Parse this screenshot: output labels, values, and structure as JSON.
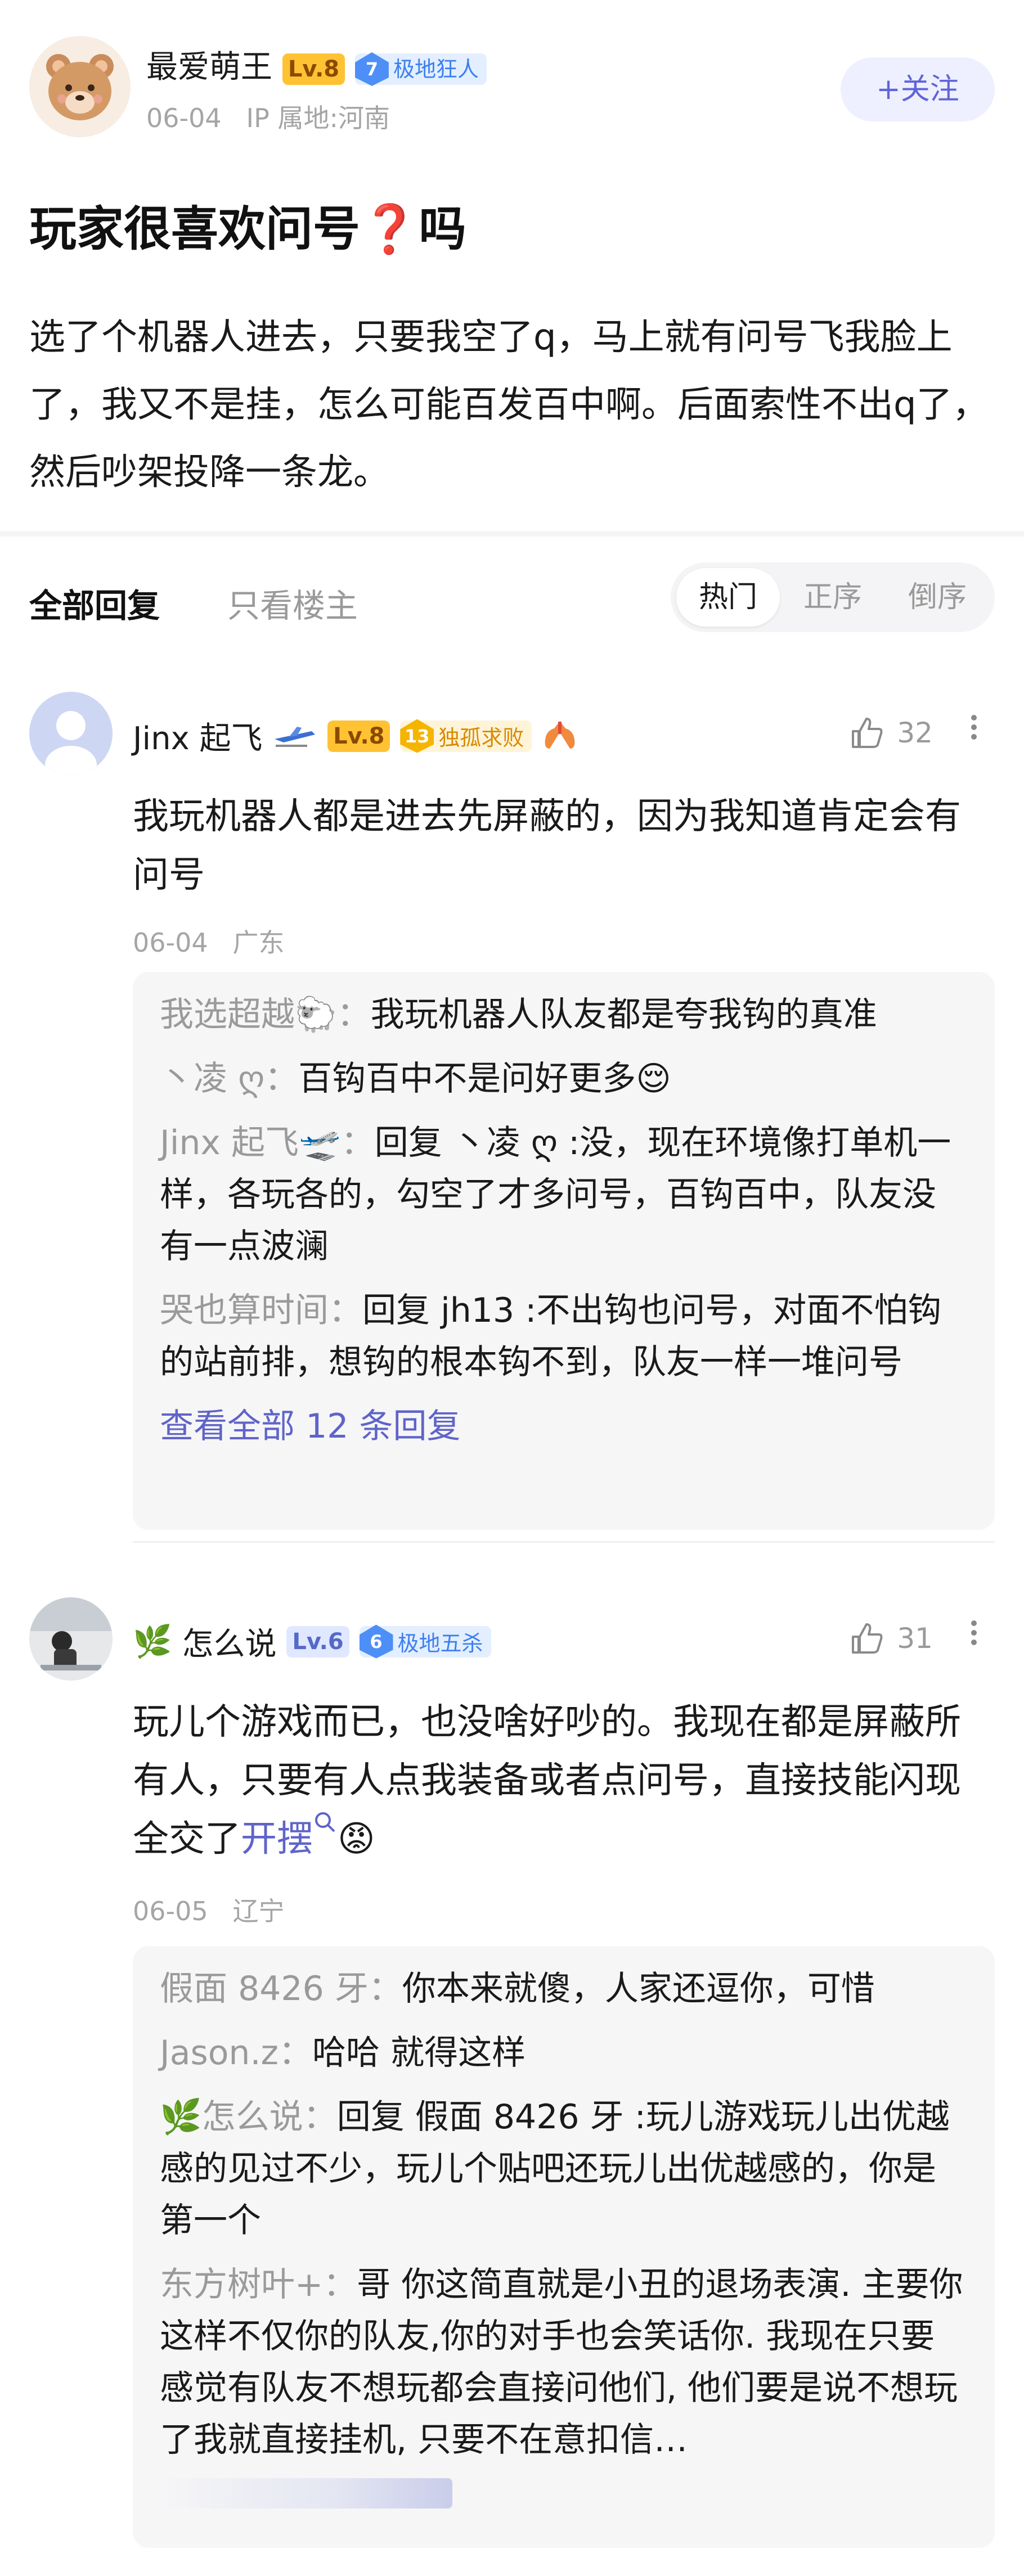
{
  "post": {
    "author": "最爱萌王",
    "level": "Lv.8",
    "tier_number": "7",
    "tier_label": "极地狂人",
    "date": "06-04",
    "ip": "IP 属地:河南",
    "follow_label": "+关注",
    "title": "玩家很喜欢问号",
    "title_suffix": "吗",
    "body": "选了个机器人进去，只要我空了q，马上就有问号飞我脸上了，我又不是挂，怎么可能百发百中啊。后面索性不出q了，然后吵架投降一条龙。"
  },
  "tabs": {
    "all_replies": "全部回复",
    "only_op": "只看楼主",
    "sort": [
      "热门",
      "正序",
      "倒序"
    ]
  },
  "comments": [
    {
      "name": "Jinx 起飞",
      "level": "Lv.8",
      "tier_number": "13",
      "tier_label": "独孤求败",
      "likes": "32",
      "text": "我玩机器人都是进去先屏蔽的，因为我知道肯定会有问号",
      "date": "06-04",
      "location": "广东",
      "replies": [
        {
          "who": "我选超越",
          "sep": "：",
          "text": "我玩机器人队友都是夸我钩的真准"
        },
        {
          "who": "丶凌 ღ",
          "sep": "：",
          "text": "百钩百中不是问好更多"
        },
        {
          "who": "Jinx 起飞",
          "sep": "：",
          "text": "回复 丶凌 ღ :没，现在环境像打单机一样，各玩各的，勾空了才多问号，百钩百中，队友没有一点波澜"
        },
        {
          "who": "哭也算时间",
          "sep": "：",
          "text": "回复 jh13 :不出钩也问号，对面不怕钩的站前排，想钩的根本钩不到，队友一样一堆问号"
        }
      ],
      "view_all": "查看全部 12 条回复"
    },
    {
      "name": "怎么说",
      "level": "Lv.6",
      "tier_number": "6",
      "tier_label": "极地五杀",
      "likes": "31",
      "text": "玩儿个游戏而已，也没啥好吵的。我现在都是屏蔽所有人，只要有人点我装备或者点问号，直接技能闪现全交了",
      "link_text": "开摆",
      "date": "06-05",
      "location": "辽宁",
      "replies": [
        {
          "who": "假面 8426 牙",
          "sep": "：",
          "text": "你本来就傻，人家还逗你，可惜"
        },
        {
          "who": "Jason.z",
          "sep": "：",
          "text": "哈哈 就得这样"
        },
        {
          "who": "怎么说",
          "sep": "：",
          "text": "回复 假面 8426 牙 :玩儿游戏玩儿出优越感的见过不少，玩儿个贴吧还玩儿出优越感的，你是第一个"
        },
        {
          "who": "东方树叶+",
          "sep": "：",
          "text": "哥 你这简直就是小丑的退场表演. 主要你这样不仅你的队友,你的对手也会笑话你. 我现在只要感觉有队友不想玩都会直接问他们, 他们要是说不想玩了我就直接挂机, 只要不在意扣信…"
        }
      ]
    }
  ],
  "colors": {
    "accent": "#5f64c9",
    "muted": "#a5a5a5",
    "level_orange": "#ffc233",
    "tier_blue": "#4d8ff7"
  }
}
